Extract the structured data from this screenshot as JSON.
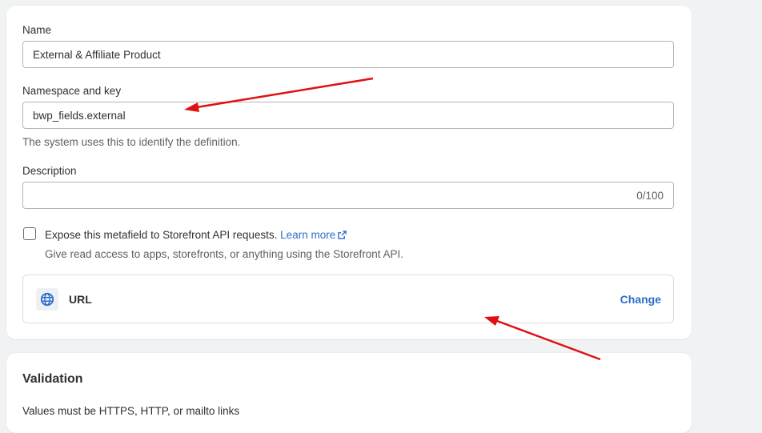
{
  "definition": {
    "name_label": "Name",
    "name_value": "External & Affiliate Product",
    "namespace_label": "Namespace and key",
    "namespace_value": "bwp_fields.external",
    "namespace_help": "The system uses this to identify the definition.",
    "description_label": "Description",
    "description_value": "",
    "description_counter": "0/100",
    "storefront_checkbox_label": "Expose this metafield to Storefront API requests.",
    "storefront_learn_more": "Learn more",
    "storefront_help": "Give read access to apps, storefronts, or anything using the Storefront API.",
    "storefront_checked": false,
    "type_icon": "globe-icon",
    "type_name": "URL",
    "type_change_label": "Change"
  },
  "validation": {
    "title": "Validation",
    "partial_text": "Values must be HTTPS, HTTP, or mailto links"
  },
  "annotations": {
    "arrow_color": "#e01010"
  },
  "colors": {
    "link": "#2c6ecb",
    "background": "#f1f2f3"
  }
}
